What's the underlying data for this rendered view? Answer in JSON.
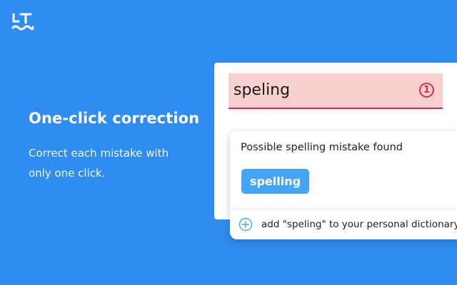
{
  "app": {
    "logo_icon": "languagetool-logo-icon"
  },
  "promo": {
    "title": "One-click correction",
    "description": "Correct each mistake with only one click."
  },
  "editor": {
    "text": "speling",
    "error_count": "1",
    "error_color": "#e0294d",
    "error_highlight": "#f9d0d0"
  },
  "popup": {
    "message": "Possible spelling mistake found",
    "suggestion": "spelling",
    "add_icon": "plus-circle-icon",
    "add_label": "add \"speling\" to your personal dictionary"
  },
  "colors": {
    "background": "#2f8cf0",
    "accent": "#45a5f5"
  }
}
